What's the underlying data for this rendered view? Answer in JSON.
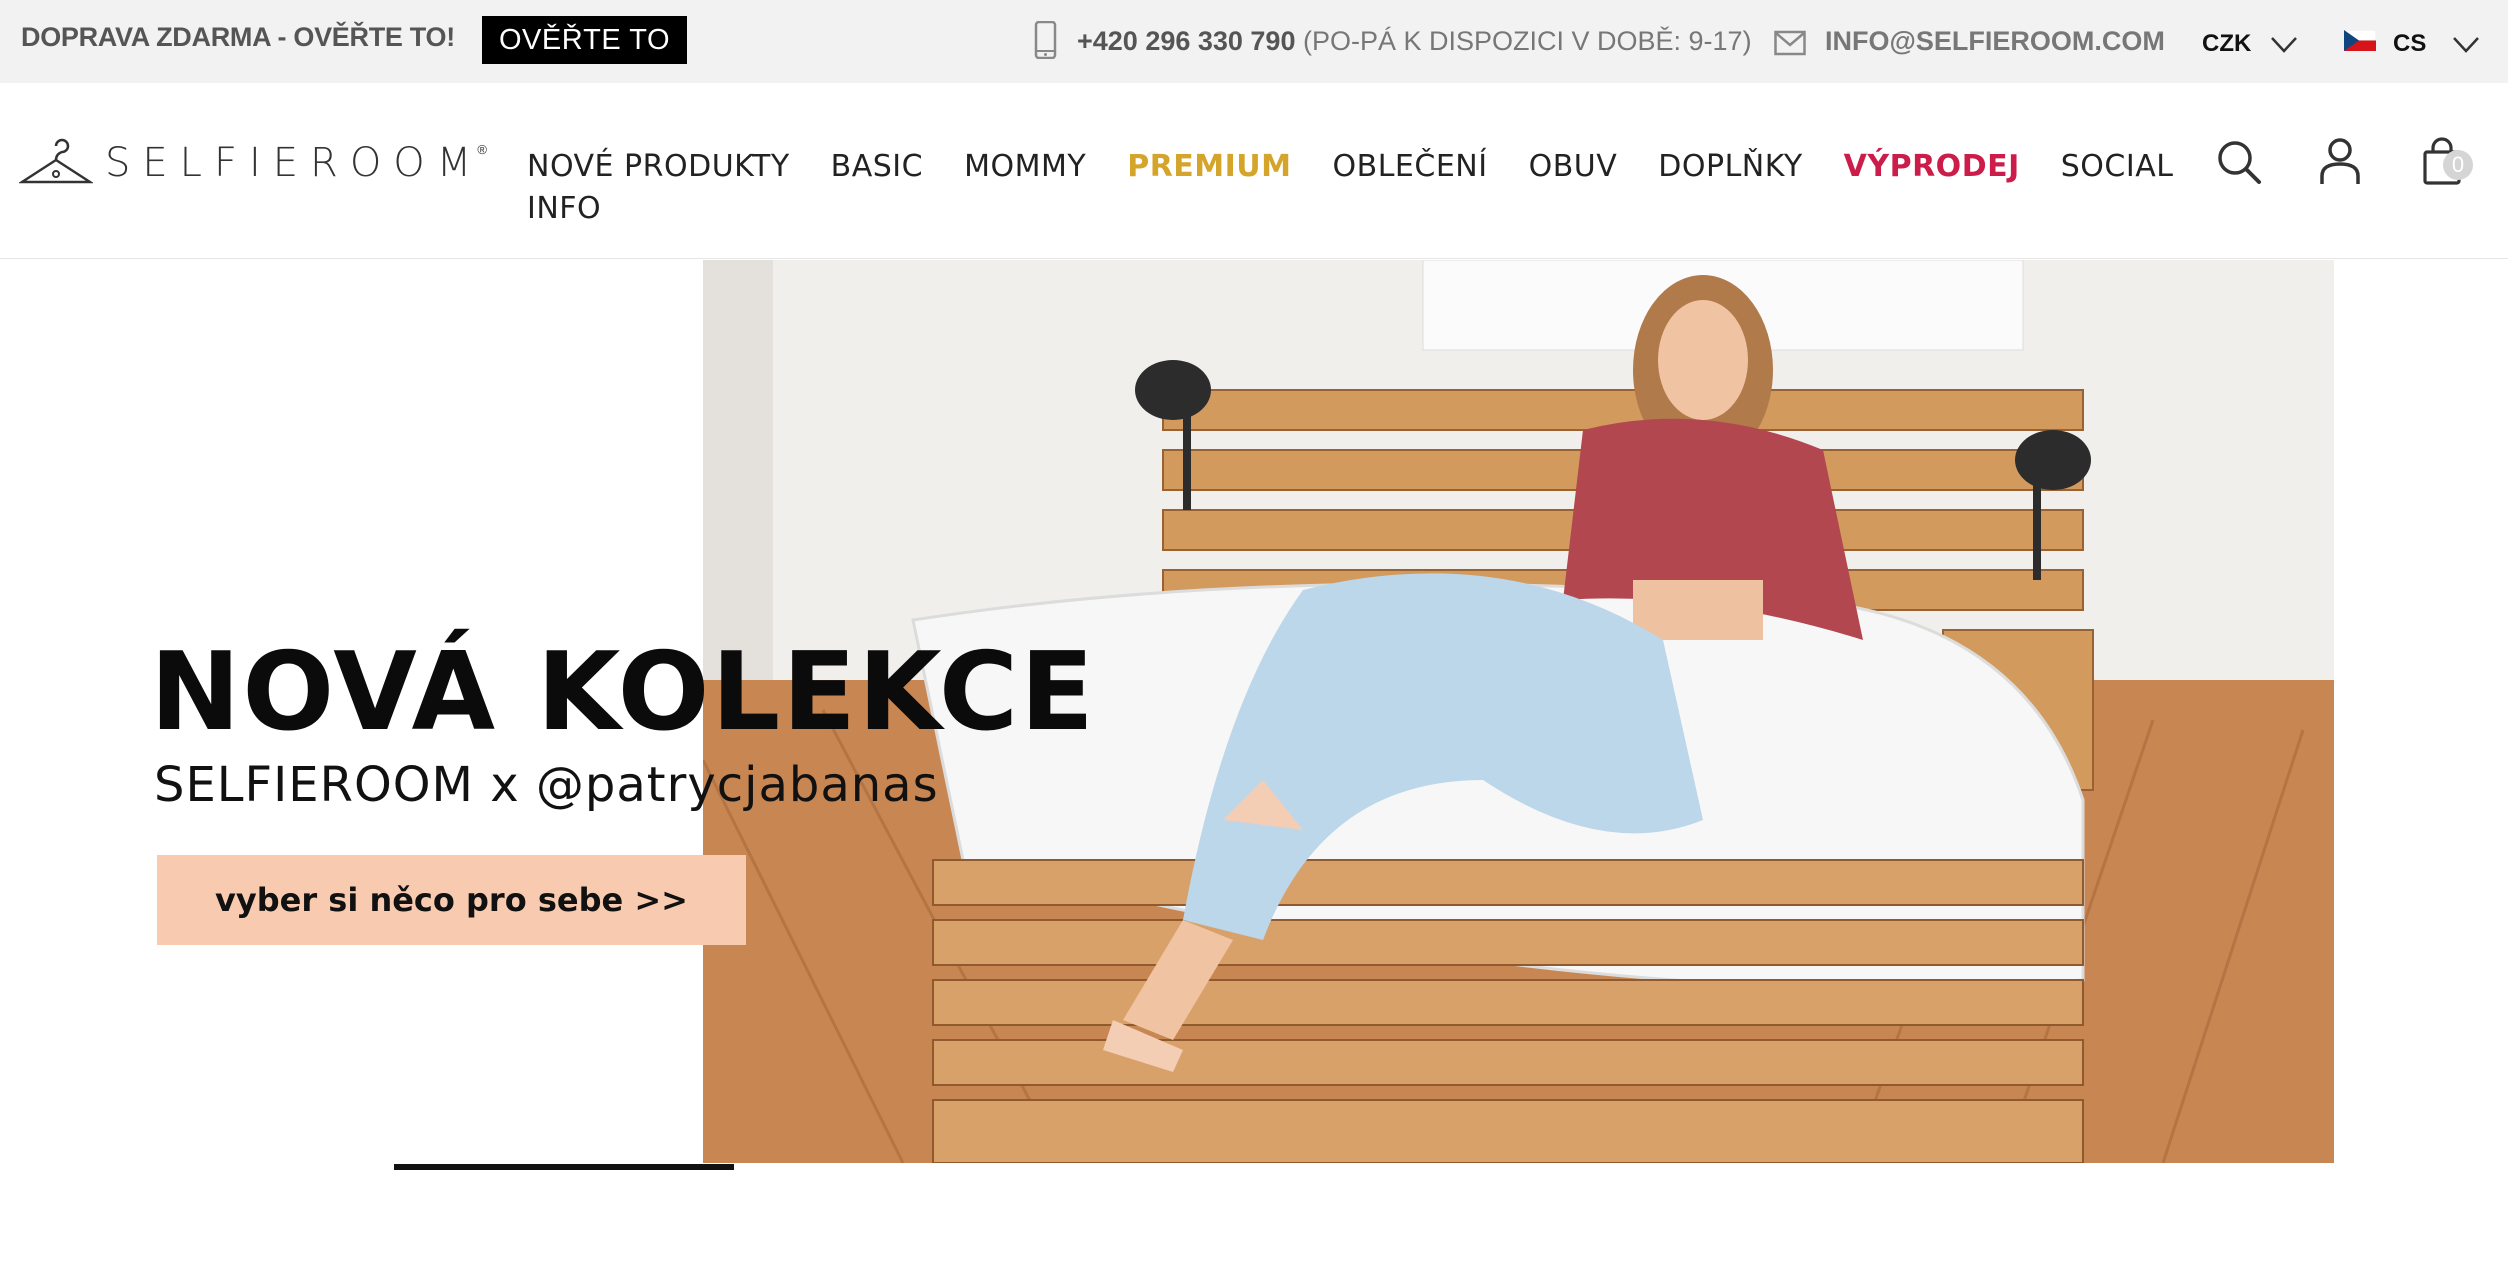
{
  "topbar": {
    "promo_text": "DOPRAVA ZDARMA - OVĚŘTE TO!",
    "promo_button": "OVĚŘTE TO",
    "phone_number": "+420 296 330 790",
    "phone_hours": " (PO-PÁ K DISPOZICI V DOBĚ: 9-17)",
    "email": "INFO@SELFIEROOM.COM",
    "currency": "CZK",
    "language": "CS"
  },
  "header": {
    "logo_text": "SELFIEROOM",
    "logo_reg": "®",
    "nav": [
      {
        "label": "NOVÉ PRODUKTY"
      },
      {
        "label": "BASIC"
      },
      {
        "label": "MOMMY"
      },
      {
        "label": "PREMIUM"
      },
      {
        "label": "OBLEČENÍ"
      },
      {
        "label": "OBUV"
      },
      {
        "label": "DOPLŇKY"
      },
      {
        "label": "VÝPRODEJ"
      },
      {
        "label": "SOCIAL"
      }
    ],
    "nav_second_row": "INFO",
    "cart_count": "0"
  },
  "hero": {
    "title": "NOVÁ KOLEKCE",
    "subtitle": "SELFIEROOM x @patrycjabanas",
    "cta": "vyber si něco pro sebe >>"
  },
  "colors": {
    "premium": "#d4a52a",
    "sale": "#cc1d4a",
    "cta_bg": "#f8cbb0",
    "topbar_bg": "#f2f2f2"
  }
}
